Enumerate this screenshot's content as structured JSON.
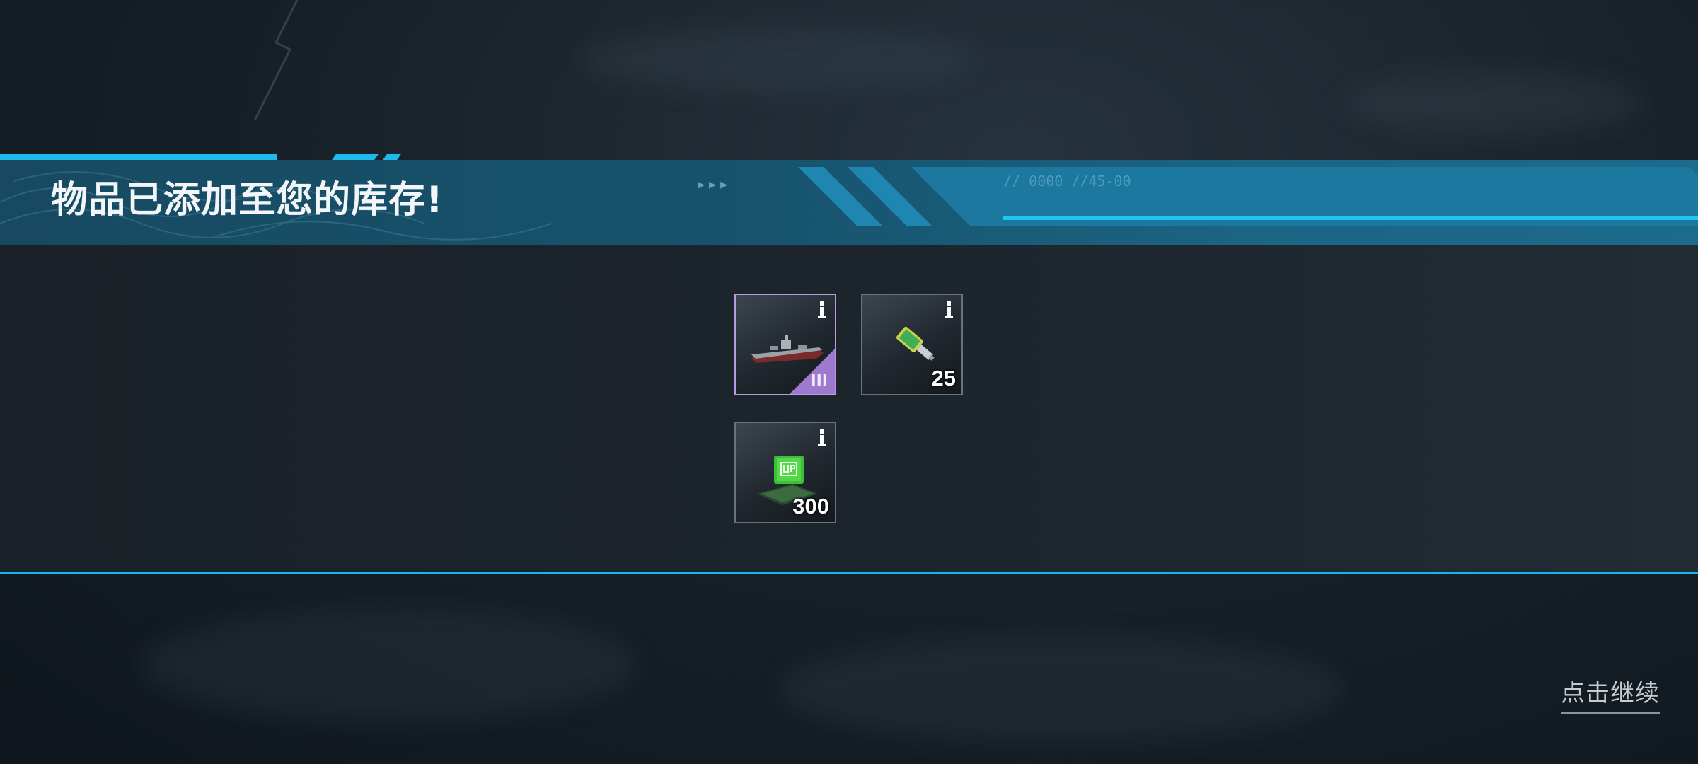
{
  "header": {
    "title": "物品已添加至您的库存!",
    "arrows": "▸▸▸",
    "code": "// 0000 //45-00"
  },
  "items": [
    {
      "name": "battleship",
      "icon": "warship-icon",
      "tier": "III",
      "rarity_color": "#9f78cf"
    },
    {
      "name": "upgrade-token",
      "icon": "flash-drive-icon",
      "quantity": "25"
    },
    {
      "name": "up-module",
      "icon": "up-chip-icon",
      "quantity": "300"
    }
  ],
  "footer": {
    "continue_label": "点击继续"
  },
  "colors": {
    "accent": "#1fb9ee",
    "banner": "#17536d",
    "rare": "#9f78cf"
  }
}
